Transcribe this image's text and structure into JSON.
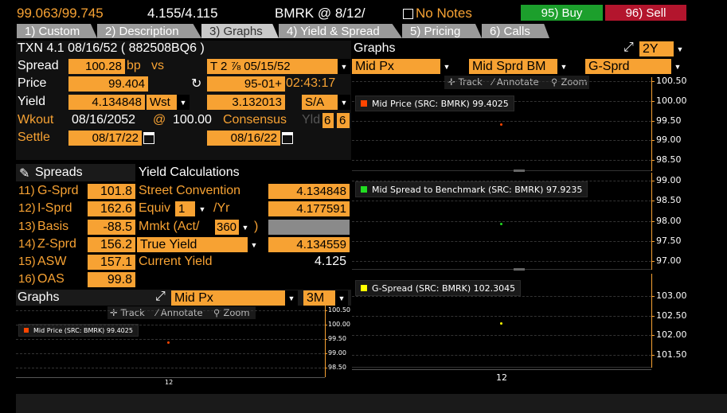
{
  "header": {
    "bid_ask": "99.063/99.745",
    "yields": "4.155/4.115",
    "bmrk": "BMRK @ 8/12/",
    "notes": "No Notes",
    "buy": "95) Buy",
    "sell": "96) Sell"
  },
  "tabs": [
    {
      "label": "1) Custom"
    },
    {
      "label": "2) Description"
    },
    {
      "label": "3) Graphs"
    },
    {
      "label": "4) Yield & Spread"
    },
    {
      "label": "5) Pricing"
    },
    {
      "label": "6) Calls"
    }
  ],
  "security": {
    "title": "TXN 4.1 08/16/52 ( 882508BQ6 )",
    "spread_label": "Spread",
    "spread_value": "100.28",
    "spread_unit": "bp",
    "vs": "vs",
    "benchmark": "T 2 ⅞ 05/15/52",
    "price_label": "Price",
    "price_value": "99.404",
    "bench_price": "95-01+",
    "bench_time": "02:43:17",
    "yield_label": "Yield",
    "yield_value": "4.134848",
    "yield_type": "Wst",
    "bench_yield": "3.132013",
    "bench_freq": "S/A",
    "wkout_label": "Wkout",
    "wkout_date": "08/16/2052",
    "wkout_at": "@",
    "wkout_price": "100.00",
    "consensus": "Consensus",
    "yld_label": "Yld",
    "yld_a": "6",
    "yld_b": "6",
    "settle_label": "Settle",
    "settle_date": "08/17/22",
    "bench_settle": "08/16/22"
  },
  "spreads": {
    "heading": "Spreads",
    "items": [
      {
        "num": "11)",
        "name": "G-Sprd",
        "value": "101.8"
      },
      {
        "num": "12)",
        "name": "I-Sprd",
        "value": "162.6"
      },
      {
        "num": "13)",
        "name": "Basis",
        "value": "-88.5"
      },
      {
        "num": "14)",
        "name": "Z-Sprd",
        "value": "156.2"
      },
      {
        "num": "15)",
        "name": "ASW",
        "value": "157.1"
      },
      {
        "num": "16)",
        "name": "OAS",
        "value": "99.8"
      }
    ]
  },
  "yield_calc": {
    "heading": "Yield Calculations",
    "street_label": "Street Convention",
    "street_value": "4.134848",
    "equiv_label": "Equiv",
    "equiv_n": "1",
    "equiv_per": "/Yr",
    "equiv_value": "4.177591",
    "mmkt_label": "Mmkt (Act/",
    "mmkt_basis": "360",
    "mmkt_close": ")",
    "true_label": "True Yield",
    "true_value": "4.134559",
    "current_label": "Current Yield",
    "current_value": "4.125"
  },
  "small_graph": {
    "title": "Graphs",
    "series_select": "Mid Px",
    "period": "3M",
    "tools": [
      "Track",
      "Annotate",
      "Zoom"
    ],
    "legend": "Mid Price (SRC: BMRK) 99.4025",
    "x_tick": "12"
  },
  "big_graph": {
    "title": "Graphs",
    "period": "2Y",
    "selects": [
      "Mid Px",
      "Mid Sprd BM",
      "G-Sprd"
    ],
    "tools": [
      "Track",
      "Annotate",
      "Zoom"
    ],
    "x_tick": "12"
  },
  "colors": {
    "orange": "#f7a233",
    "buy_green": "#1c9f2c",
    "sell_red": "#b3152d",
    "series_price": "#ff4500",
    "series_spread": "#22dd22",
    "series_gspread": "#ffff00"
  },
  "chart_data": [
    {
      "type": "scatter",
      "series": [
        {
          "name": "Mid Price (SRC: BMRK) 99.4025",
          "x": [
            "12"
          ],
          "values": [
            99.4025
          ]
        }
      ],
      "ylim": [
        98.5,
        100.5
      ],
      "yticks": [
        "100.50",
        "100.00",
        "99.50",
        "99.00",
        "98.50"
      ],
      "x_ticks": [
        "12"
      ]
    },
    {
      "type": "scatter",
      "series": [
        {
          "name": "Mid Spread to Benchmark (SRC: BMRK) 97.9235",
          "x": [
            "12"
          ],
          "values": [
            97.9235
          ]
        }
      ],
      "ylim": [
        97.0,
        99.0
      ],
      "yticks": [
        "99.00",
        "98.50",
        "98.00",
        "97.50",
        "97.00"
      ],
      "x_ticks": [
        "12"
      ]
    },
    {
      "type": "scatter",
      "series": [
        {
          "name": "G-Spread (SRC: BMRK) 102.3045",
          "x": [
            "12"
          ],
          "values": [
            102.3045
          ]
        }
      ],
      "ylim": [
        101.5,
        103.0
      ],
      "yticks": [
        "103.00",
        "102.50",
        "102.00",
        "101.50"
      ],
      "x_ticks": [
        "12"
      ]
    },
    {
      "type": "scatter",
      "series": [
        {
          "name": "Mid Price (SRC: BMRK) 99.4025",
          "x": [
            "12"
          ],
          "values": [
            99.4025
          ]
        }
      ],
      "ylim": [
        98.5,
        100.5
      ],
      "yticks": [
        "100.50",
        "100.00",
        "99.50",
        "99.00",
        "98.50"
      ],
      "x_ticks": [
        "12"
      ]
    }
  ]
}
